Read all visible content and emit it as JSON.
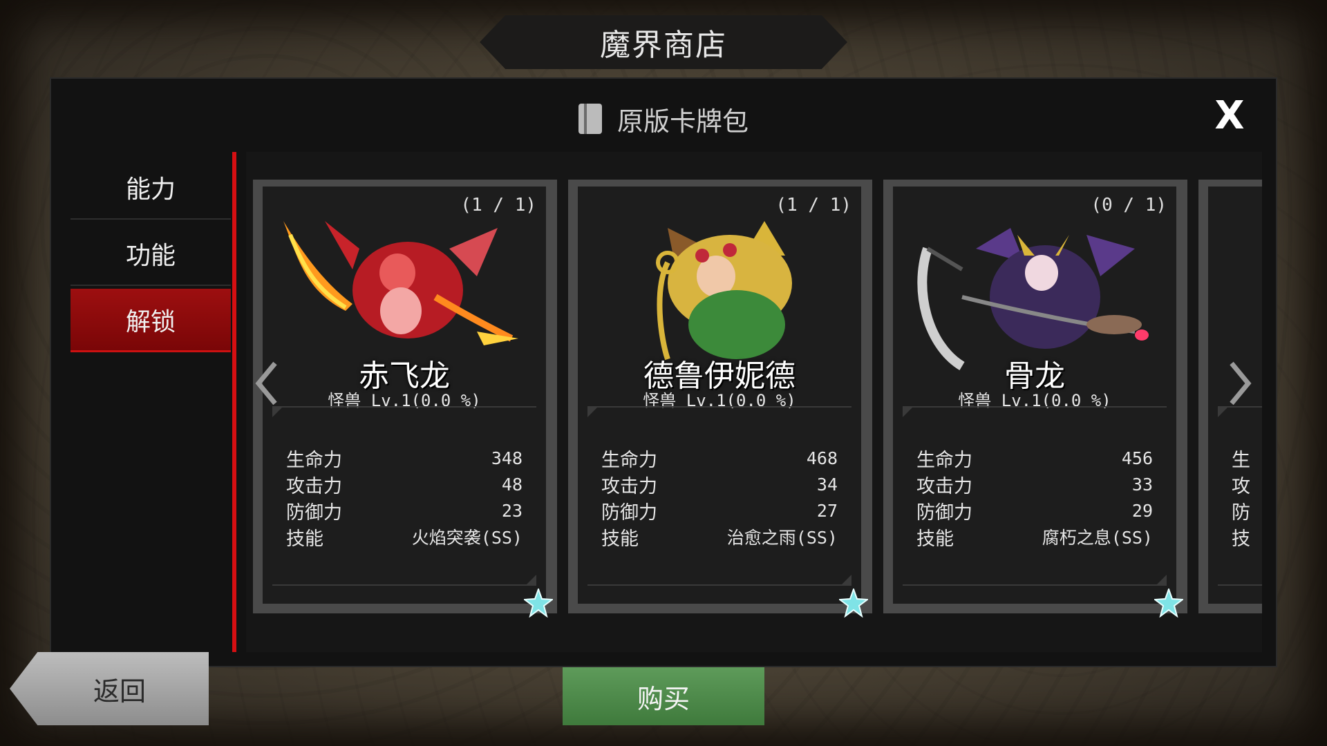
{
  "header": {
    "title": "魔界商店"
  },
  "panel": {
    "pack_title": "原版卡牌包",
    "close_label": "X"
  },
  "sidebar": {
    "items": [
      {
        "label": "能力",
        "active": false
      },
      {
        "label": "功能",
        "active": false
      },
      {
        "label": "解锁",
        "active": true
      }
    ]
  },
  "cards": [
    {
      "count": "(1 / 1)",
      "name": "赤飞龙",
      "subtitle": "怪兽 Lv.1(0.0 %)",
      "stats": [
        {
          "label": "生命力",
          "value": "348"
        },
        {
          "label": "攻击力",
          "value": "48"
        },
        {
          "label": "防御力",
          "value": "23"
        },
        {
          "label": "技能",
          "value": "火焰突袭(SS)"
        }
      ],
      "art_icon": "red-dragon-girl-icon"
    },
    {
      "count": "(1 / 1)",
      "name": "德鲁伊妮德",
      "subtitle": "怪兽 Lv.1(0.0 %)",
      "stats": [
        {
          "label": "生命力",
          "value": "468"
        },
        {
          "label": "攻击力",
          "value": "34"
        },
        {
          "label": "防御力",
          "value": "27"
        },
        {
          "label": "技能",
          "value": "治愈之雨(SS)"
        }
      ],
      "art_icon": "druid-girl-icon"
    },
    {
      "count": "(0 / 1)",
      "name": "骨龙",
      "subtitle": "怪兽 Lv.1(0.0 %)",
      "stats": [
        {
          "label": "生命力",
          "value": "456"
        },
        {
          "label": "攻击力",
          "value": "33"
        },
        {
          "label": "防御力",
          "value": "29"
        },
        {
          "label": "技能",
          "value": "腐朽之息(SS)"
        }
      ],
      "art_icon": "bone-dragon-icon"
    }
  ],
  "partial_card": {
    "labels": [
      "生",
      "攻",
      "防",
      "技"
    ]
  },
  "footer": {
    "back_label": "返回",
    "buy_label": "购买"
  },
  "colors": {
    "accent_red": "#d60f12",
    "buy_green": "#4f8a4b",
    "star_cyan": "#7fe3e6"
  }
}
